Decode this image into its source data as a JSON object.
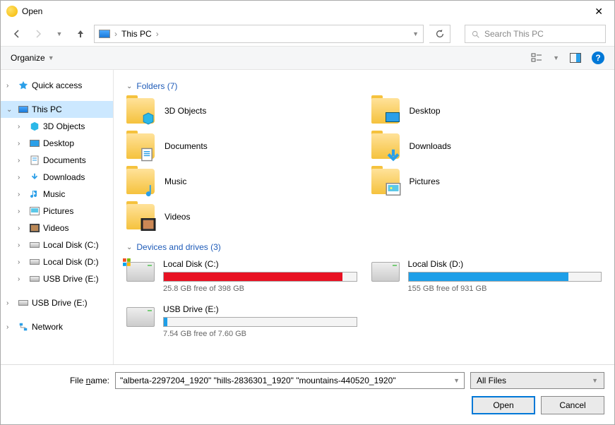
{
  "title": "Open",
  "address": {
    "location": "This PC"
  },
  "search": {
    "placeholder": "Search This PC"
  },
  "toolbar": {
    "organize": "Organize"
  },
  "sidebar": {
    "quick": "Quick access",
    "thispc": "This PC",
    "items": [
      {
        "label": "3D Objects"
      },
      {
        "label": "Desktop"
      },
      {
        "label": "Documents"
      },
      {
        "label": "Downloads"
      },
      {
        "label": "Music"
      },
      {
        "label": "Pictures"
      },
      {
        "label": "Videos"
      },
      {
        "label": "Local Disk (C:)"
      },
      {
        "label": "Local Disk (D:)"
      },
      {
        "label": "USB Drive (E:)"
      }
    ],
    "usb": "USB Drive (E:)",
    "network": "Network"
  },
  "sections": {
    "folders": "Folders (7)",
    "drives": "Devices and drives (3)"
  },
  "folders": [
    {
      "label": "3D Objects"
    },
    {
      "label": "Desktop"
    },
    {
      "label": "Documents"
    },
    {
      "label": "Downloads"
    },
    {
      "label": "Music"
    },
    {
      "label": "Pictures"
    },
    {
      "label": "Videos"
    }
  ],
  "drives": [
    {
      "name": "Local Disk (C:)",
      "free": "25.8 GB free of 398 GB",
      "pct": 93,
      "color": "#e81123"
    },
    {
      "name": "Local Disk (D:)",
      "free": "155 GB free of 931 GB",
      "pct": 83,
      "color": "#1e9fe8"
    },
    {
      "name": "USB Drive (E:)",
      "free": "7.54 GB free of 7.60 GB",
      "pct": 2,
      "color": "#1e9fe8"
    }
  ],
  "footer": {
    "label": "File name:",
    "value": "\"alberta-2297204_1920\" \"hills-2836301_1920\" \"mountains-440520_1920\"",
    "filter": "All Files",
    "open": "Open",
    "cancel": "Cancel"
  }
}
